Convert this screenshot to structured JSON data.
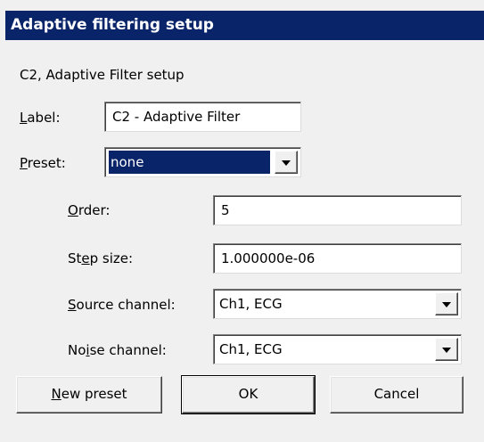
{
  "window": {
    "title": "Adaptive filtering setup"
  },
  "dialog": {
    "subtitle": "C2, Adaptive Filter setup",
    "label_caption_hotkey": "L",
    "label_caption_rest": "abel:",
    "label_value": "C2 - Adaptive Filter",
    "preset_caption_hotkey": "P",
    "preset_caption_rest": "reset:",
    "preset_value": "none",
    "order_caption_hotkey": "O",
    "order_caption_rest": "rder:",
    "order_value": "5",
    "step_caption_pre": "St",
    "step_caption_hotkey": "e",
    "step_caption_rest": "p size:",
    "step_value": "1.000000e-06",
    "source_caption_hotkey": "S",
    "source_caption_rest": "ource channel:",
    "source_value": "Ch1, ECG",
    "noise_caption_pre": "No",
    "noise_caption_hotkey": "i",
    "noise_caption_rest": "se channel:",
    "noise_value": "Ch1, ECG"
  },
  "buttons": {
    "new_preset_hotkey": "N",
    "new_preset_rest": "ew preset",
    "ok": "OK",
    "cancel": "Cancel"
  },
  "colors": {
    "titlebar": "#0a246a",
    "face": "#f0f0f0",
    "selection": "#0a246a"
  },
  "icons": {
    "dropdown": "chevron-down-icon"
  }
}
